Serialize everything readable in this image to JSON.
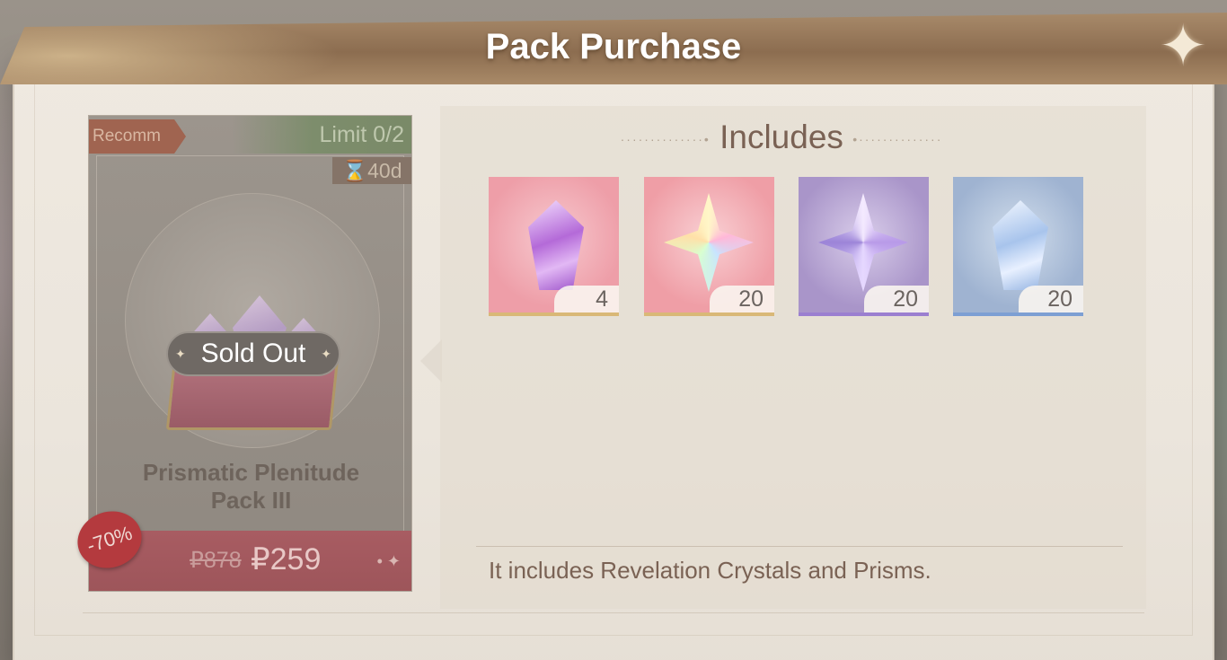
{
  "dialog": {
    "title": "Pack Purchase"
  },
  "pack": {
    "tag": "Recomm",
    "limit": "Limit 0/2",
    "timer": "⌛40d",
    "status": "Sold Out",
    "name_line1": "Prismatic Plenitude",
    "name_line2": "Pack III",
    "original_price": "₽878",
    "price": "₽259",
    "discount": "-70%"
  },
  "includes": {
    "title": "Includes",
    "items": [
      {
        "quantity": "4",
        "icon": "revelation-crystal-icon"
      },
      {
        "quantity": "20",
        "icon": "prism-rainbow-icon"
      },
      {
        "quantity": "20",
        "icon": "prism-purple-icon"
      },
      {
        "quantity": "20",
        "icon": "prism-blue-icon"
      }
    ],
    "description": "It includes Revelation Crystals and Prisms."
  }
}
